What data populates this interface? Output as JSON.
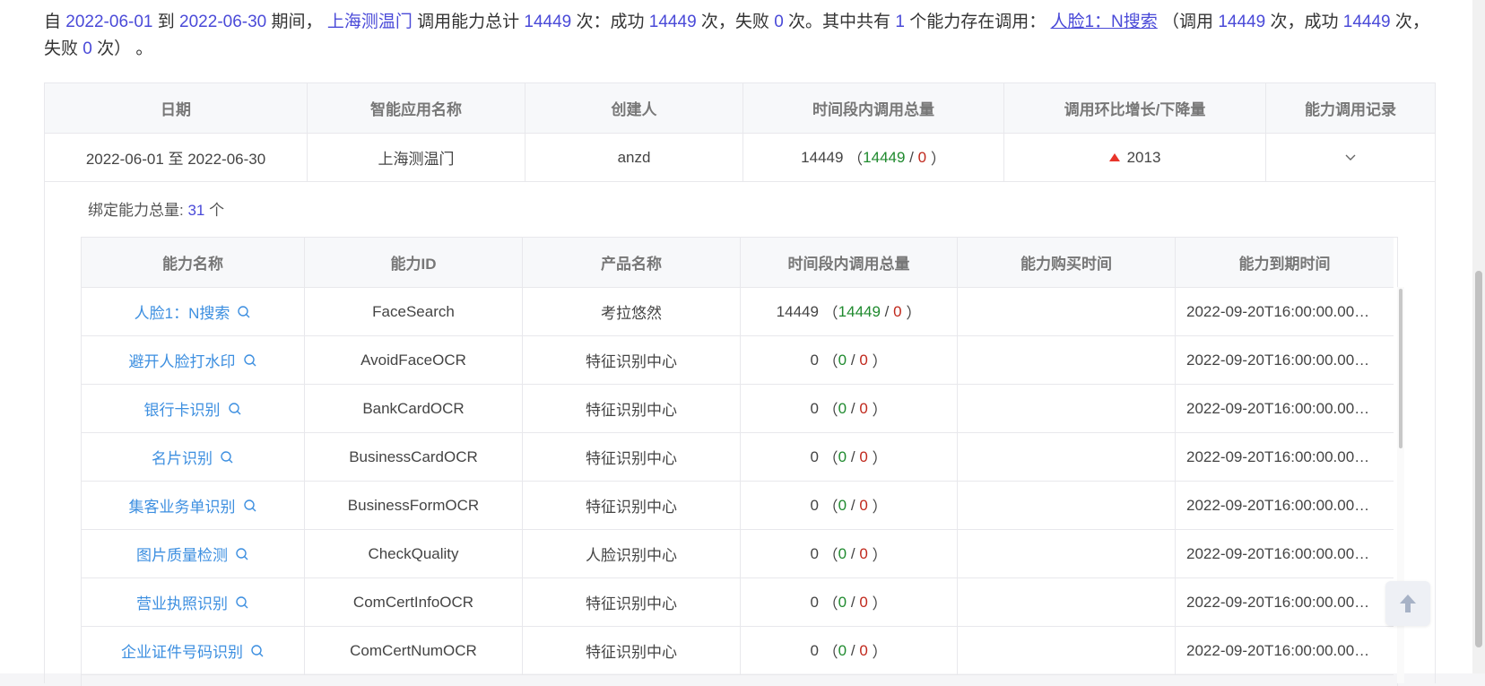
{
  "summary": {
    "p1": "自 ",
    "start_date": "2022-06-01",
    "p2": " 到 ",
    "end_date": "2022-06-30",
    "p3": " 期间， ",
    "app_name": "上海测温门",
    "p4": " 调用能力总计 ",
    "total_calls": "14449",
    "p5": " 次：成功 ",
    "success_calls": "14449",
    "p6": " 次，失败 ",
    "fail_calls": "0",
    "p7": " 次。其中共有 ",
    "ability_count": "1",
    "p8": " 个能力存在调用： ",
    "ability_link": "人脸1：N搜索",
    "p9": " （调用 ",
    "ability_calls": "14449",
    "p10": " 次，成功 ",
    "ability_success": "14449",
    "p11": " 次，失败 ",
    "ability_fail": "0",
    "p12": " 次） 。"
  },
  "main_table": {
    "headers": [
      "日期",
      "智能应用名称",
      "创建人",
      "时间段内调用总量",
      "调用环比增长/下降量",
      "能力调用记录"
    ],
    "row": {
      "date": "2022-06-01 至 2022-06-30",
      "app": "上海测温门",
      "creator": "anzd",
      "total": "14449",
      "success": "14449",
      "fail": "0",
      "growth": "2013"
    }
  },
  "bind": {
    "label": "绑定能力总量: ",
    "count": "31",
    "unit": " 个"
  },
  "sub_table": {
    "headers": [
      "能力名称",
      "能力ID",
      "产品名称",
      "时间段内调用总量",
      "能力购买时间",
      "能力到期时间"
    ],
    "rows": [
      {
        "name": "人脸1：N搜索",
        "id": "FaceSearch",
        "product": "考拉悠然",
        "total": "14449",
        "success": "14449",
        "fail": "0",
        "buy": "",
        "expire": "2022-09-20T16:00:00.00…"
      },
      {
        "name": "避开人脸打水印",
        "id": "AvoidFaceOCR",
        "product": "特征识别中心",
        "total": "0",
        "success": "0",
        "fail": "0",
        "buy": "",
        "expire": "2022-09-20T16:00:00.00…"
      },
      {
        "name": "银行卡识别",
        "id": "BankCardOCR",
        "product": "特征识别中心",
        "total": "0",
        "success": "0",
        "fail": "0",
        "buy": "",
        "expire": "2022-09-20T16:00:00.00…"
      },
      {
        "name": "名片识别",
        "id": "BusinessCardOCR",
        "product": "特征识别中心",
        "total": "0",
        "success": "0",
        "fail": "0",
        "buy": "",
        "expire": "2022-09-20T16:00:00.00…"
      },
      {
        "name": "集客业务单识别",
        "id": "BusinessFormOCR",
        "product": "特征识别中心",
        "total": "0",
        "success": "0",
        "fail": "0",
        "buy": "",
        "expire": "2022-09-20T16:00:00.00…"
      },
      {
        "name": "图片质量检测",
        "id": "CheckQuality",
        "product": "人脸识别中心",
        "total": "0",
        "success": "0",
        "fail": "0",
        "buy": "",
        "expire": "2022-09-20T16:00:00.00…"
      },
      {
        "name": "营业执照识别",
        "id": "ComCertInfoOCR",
        "product": "特征识别中心",
        "total": "0",
        "success": "0",
        "fail": "0",
        "buy": "",
        "expire": "2022-09-20T16:00:00.00…"
      },
      {
        "name": "企业证件号码识别",
        "id": "ComCertNumOCR",
        "product": "特征识别中心",
        "total": "0",
        "success": "0",
        "fail": "0",
        "buy": "",
        "expire": "2022-09-20T16:00:00.00…"
      }
    ]
  },
  "icons": {
    "search": "search-icon",
    "growth_up": "triangle-up-icon",
    "expand": "chevron-down-icon",
    "back_to_top": "arrow-up-icon"
  },
  "colors": {
    "accent_blue": "#4a4ad8",
    "link_blue": "#3d8fe0",
    "success_green": "#1f8a2e",
    "fail_red": "#c0281c",
    "header_bg": "#f7f8fa"
  }
}
